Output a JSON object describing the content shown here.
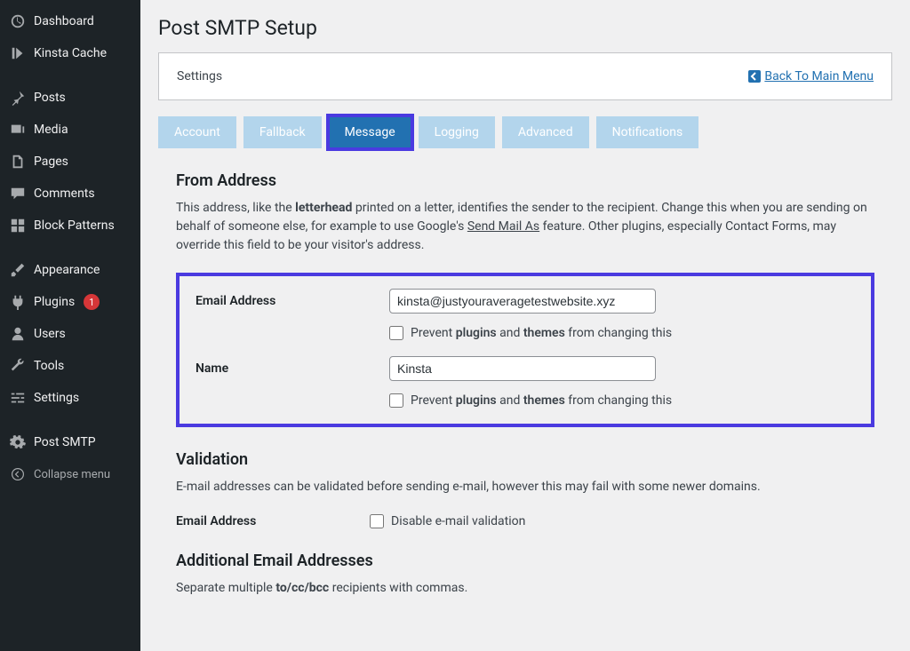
{
  "sidebar": {
    "items": [
      {
        "label": "Dashboard"
      },
      {
        "label": "Kinsta Cache"
      }
    ],
    "items2": [
      {
        "label": "Posts"
      },
      {
        "label": "Media"
      },
      {
        "label": "Pages"
      },
      {
        "label": "Comments"
      },
      {
        "label": "Block Patterns"
      }
    ],
    "items3": [
      {
        "label": "Appearance"
      },
      {
        "label": "Plugins",
        "badge": "1"
      },
      {
        "label": "Users"
      },
      {
        "label": "Tools"
      },
      {
        "label": "Settings"
      }
    ],
    "items4": [
      {
        "label": "Post SMTP"
      },
      {
        "label": "Collapse menu"
      }
    ]
  },
  "page": {
    "title": "Post SMTP Setup",
    "settings_label": "Settings",
    "back_link": "Back To Main Menu"
  },
  "tabs": {
    "t0": "Account",
    "t1": "Fallback",
    "t2": "Message",
    "t3": "Logging",
    "t4": "Advanced",
    "t5": "Notifications"
  },
  "from_section": {
    "heading": "From Address",
    "desc_p1": "This address, like the ",
    "desc_b1": "letterhead",
    "desc_p2": " printed on a letter, identifies the sender to the recipient. Change this when you are sending on behalf of someone else, for example to use Google's ",
    "desc_u1": "Send Mail As",
    "desc_p3": " feature. Other plugins, especially Contact Forms, may override this field to be your visitor's address.",
    "email_label": "Email Address",
    "email_value": "kinsta@justyouraveragetestwebsite.xyz",
    "name_label": "Name",
    "name_value": "Kinsta",
    "prevent_p1": "Prevent ",
    "prevent_b1": "plugins",
    "prevent_p2": " and ",
    "prevent_b2": "themes",
    "prevent_p3": " from changing this"
  },
  "validation_section": {
    "heading": "Validation",
    "desc": "E-mail addresses can be validated before sending e-mail, however this may fail with some newer domains.",
    "label": "Email Address",
    "checkbox": "Disable e-mail validation"
  },
  "additional_section": {
    "heading": "Additional Email Addresses",
    "desc_p1": "Separate multiple ",
    "desc_b1": "to/cc/bcc",
    "desc_p2": " recipients with commas."
  }
}
